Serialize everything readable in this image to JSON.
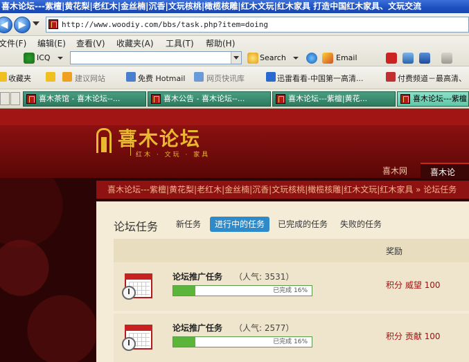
{
  "window": {
    "title": "喜木论坛---紫檀|黄花梨|老红木|金丝楠|沉香|文玩核桃|橄榄核雕|红木文玩|红木家具 打造中国红木家具、文玩交流"
  },
  "address": {
    "url": "http://www.woodiy.com/bbs/task.php?item=doing"
  },
  "menu": {
    "items": [
      "文件(F)",
      "编辑(E)",
      "查看(V)",
      "收藏夹(A)",
      "工具(T)",
      "帮助(H)"
    ]
  },
  "toolbar": {
    "icq_label": "ICQ",
    "search_label": "Search",
    "email_label": "Email"
  },
  "favorites": {
    "label": "收藏夹",
    "items": [
      "建议网站",
      "免费 Hotmail",
      "网页快讯库",
      "迅雷看看-中国第一高清...",
      "付费频道－最高清、"
    ]
  },
  "tabs": [
    "喜木茶馆 - 喜木论坛--...",
    "喜木公告 - 喜木论坛--...",
    "喜木论坛---紫檀|黄花...",
    "喜木论坛---紫檀"
  ],
  "site": {
    "logo_text": "喜木论坛",
    "logo_sub": "红木 · 文玩 · 家具",
    "nav": [
      "喜木网",
      "喜木论坛"
    ],
    "breadcrumb": "喜木论坛---紫檀|黄花梨|老红木|金丝楠|沉香|文玩核桃|橄榄核雕|红木文玩|红木家具 » 论坛任务"
  },
  "panel": {
    "title": "论坛任务",
    "subtabs": [
      "新任务",
      "进行中的任务",
      "已完成的任务",
      "失败的任务"
    ],
    "reward_header": "奖励",
    "tasks": [
      {
        "name": "论坛推广任务",
        "popularity": "（人气: 3531）",
        "progress_pct": 16,
        "progress_text": "已完成 16%",
        "reward": "积分 威望 100"
      },
      {
        "name": "论坛推广任务",
        "popularity": "（人气: 2577）",
        "progress_pct": 16,
        "progress_text": "已完成 16%",
        "reward": "积分 贡献 100"
      }
    ]
  }
}
